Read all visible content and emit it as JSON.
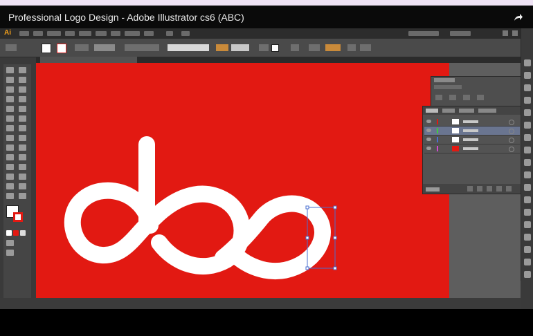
{
  "video": {
    "title": "Professional Logo Design - Adobe Illustrator cs6 (ABC)",
    "share_icon": "share-arrow-icon"
  },
  "app": {
    "name": "Adobe Illustrator CS6",
    "logo": "Ai"
  },
  "colors": {
    "artboard": "#e21912",
    "logo": "#ffffff",
    "selection": "#4a6fd0",
    "layer_selected": "#6a7590"
  }
}
